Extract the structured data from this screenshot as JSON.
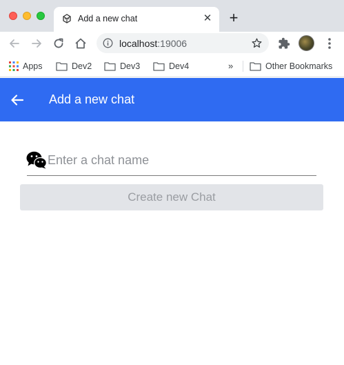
{
  "browser": {
    "tab": {
      "title": "Add a new chat",
      "close_glyph": "✕"
    },
    "new_tab_glyph": "+",
    "omnibox": {
      "host": "localhost",
      "port": ":19006"
    },
    "bookmarks": {
      "items": [
        "Apps",
        "Dev2",
        "Dev3",
        "Dev4"
      ],
      "overflow_glyph": "»",
      "other": "Other Bookmarks"
    }
  },
  "app": {
    "header": {
      "title": "Add a new chat"
    },
    "form": {
      "chat_name": {
        "value": "",
        "placeholder": "Enter a chat name"
      },
      "create_label": "Create new Chat",
      "create_disabled": true
    }
  },
  "colors": {
    "header_bg": "#2f6bf2",
    "button_disabled_bg": "#e2e4e8",
    "button_disabled_text": "#9a9da2"
  },
  "icons": [
    "back-arrow-icon",
    "wechat-icon",
    "star-icon",
    "puzzle-icon",
    "folder-icon",
    "apps-grid-icon"
  ]
}
